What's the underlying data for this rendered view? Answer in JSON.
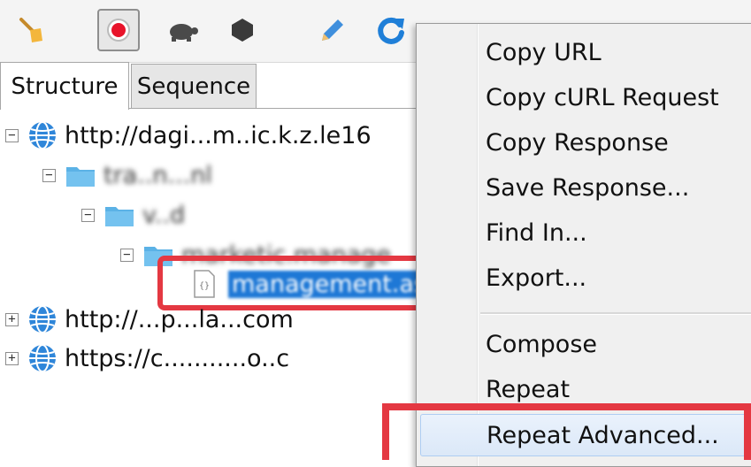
{
  "toolbar": {
    "buttons": [
      {
        "icon": "broom-icon"
      },
      {
        "icon": "record-icon",
        "pressed": true
      },
      {
        "icon": "turtle-icon"
      },
      {
        "icon": "stop-hexagon-icon"
      },
      {
        "icon": "pen-icon"
      },
      {
        "icon": "refresh-icon"
      }
    ]
  },
  "tabs": {
    "structure": "Structure",
    "sequence": "Sequence"
  },
  "tree": {
    "host1": "http://dagi...m..ic.k.z.le16",
    "folder1": "tra..n...nl",
    "folder2": "v..d",
    "folder3": "marketic.manage",
    "file": "management.as",
    "host2": "http://...p...la...com",
    "host3": "https://c...........o..c"
  },
  "menu": {
    "items": [
      "Copy URL",
      "Copy cURL Request",
      "Copy Response",
      "Save Response...",
      "Find In...",
      "Export...",
      "Compose",
      "Repeat",
      "Repeat Advanced..."
    ]
  },
  "colors": {
    "highlight": "#e43842",
    "selection": "#1e78d6",
    "globe": "#2f86d9",
    "folder": "#5bb2e6"
  }
}
